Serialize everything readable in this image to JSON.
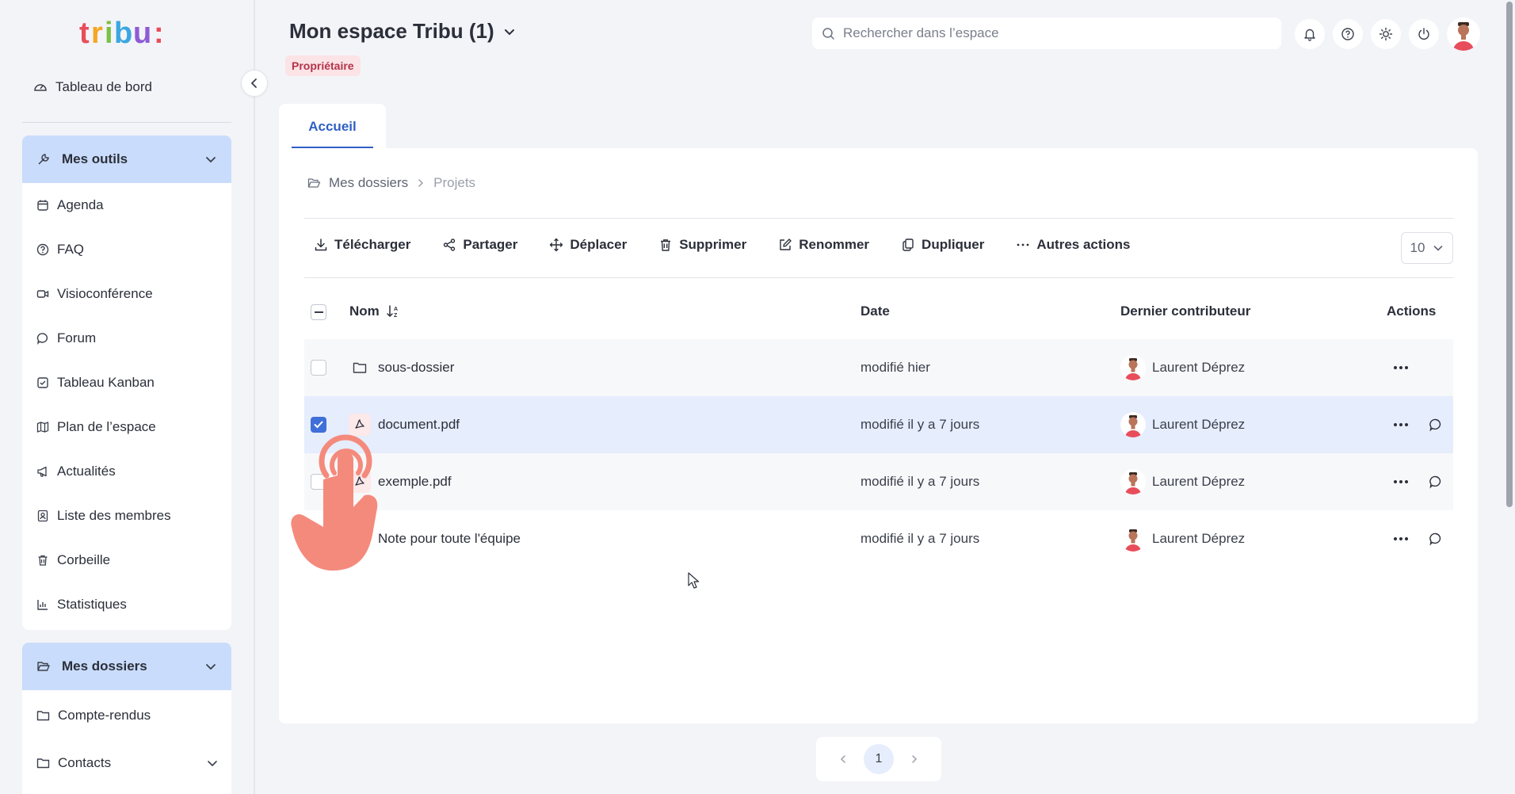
{
  "app": {
    "logo_text": "tribu:"
  },
  "sidebar": {
    "dashboard_label": "Tableau de bord",
    "tools_header": "Mes outils",
    "tools": [
      {
        "label": "Agenda",
        "icon": "calendar-icon"
      },
      {
        "label": "FAQ",
        "icon": "help-icon"
      },
      {
        "label": "Visioconférence",
        "icon": "video-icon"
      },
      {
        "label": "Forum",
        "icon": "chat-icon"
      },
      {
        "label": "Tableau Kanban",
        "icon": "kanban-icon"
      },
      {
        "label": "Plan de l’espace",
        "icon": "map-icon"
      },
      {
        "label": "Actualités",
        "icon": "megaphone-icon"
      },
      {
        "label": "Liste des membres",
        "icon": "contacts-icon"
      },
      {
        "label": "Corbeille",
        "icon": "trash-icon"
      },
      {
        "label": "Statistiques",
        "icon": "chart-icon"
      }
    ],
    "folders_header": "Mes dossiers",
    "folders": [
      {
        "label": "Compte-rendus"
      },
      {
        "label": "Contacts"
      }
    ]
  },
  "header": {
    "title": "Mon espace Tribu (1)",
    "role_badge": "Propriétaire",
    "search_placeholder": "Rechercher dans l’espace"
  },
  "tabs": [
    {
      "label": "Accueil"
    }
  ],
  "breadcrumb": {
    "root": "Mes dossiers",
    "current": "Projets"
  },
  "toolbar": {
    "download": "Télécharger",
    "share": "Partager",
    "move": "Déplacer",
    "delete": "Supprimer",
    "rename": "Renommer",
    "duplicate": "Dupliquer",
    "more": "Autres actions",
    "per_page": "10"
  },
  "table": {
    "columns": {
      "name": "Nom",
      "date": "Date",
      "contributor": "Dernier contributeur",
      "actions": "Actions"
    },
    "rows": [
      {
        "name": "sous-dossier",
        "type": "folder",
        "date": "modifié hier",
        "contributor": "Laurent Déprez",
        "checked": false
      },
      {
        "name": "document.pdf",
        "type": "pdf",
        "date": "modifié il y a 7 jours",
        "contributor": "Laurent Déprez",
        "checked": true
      },
      {
        "name": "exemple.pdf",
        "type": "pdf",
        "date": "modifié il y a 7 jours",
        "contributor": "Laurent Déprez",
        "checked": false
      },
      {
        "name": "Note pour toute l'équipe",
        "type": "note",
        "date": "modifié il y a 7 jours",
        "contributor": "Laurent Déprez",
        "checked": false
      }
    ]
  },
  "pagination": {
    "current_page": "1"
  },
  "colors": {
    "accent": "#2f5fc4",
    "sidebar_header": "#c9dcfb",
    "selected_row": "#e6edfc",
    "badge_bg": "#fbe3e6",
    "badge_text": "#b3344a"
  }
}
